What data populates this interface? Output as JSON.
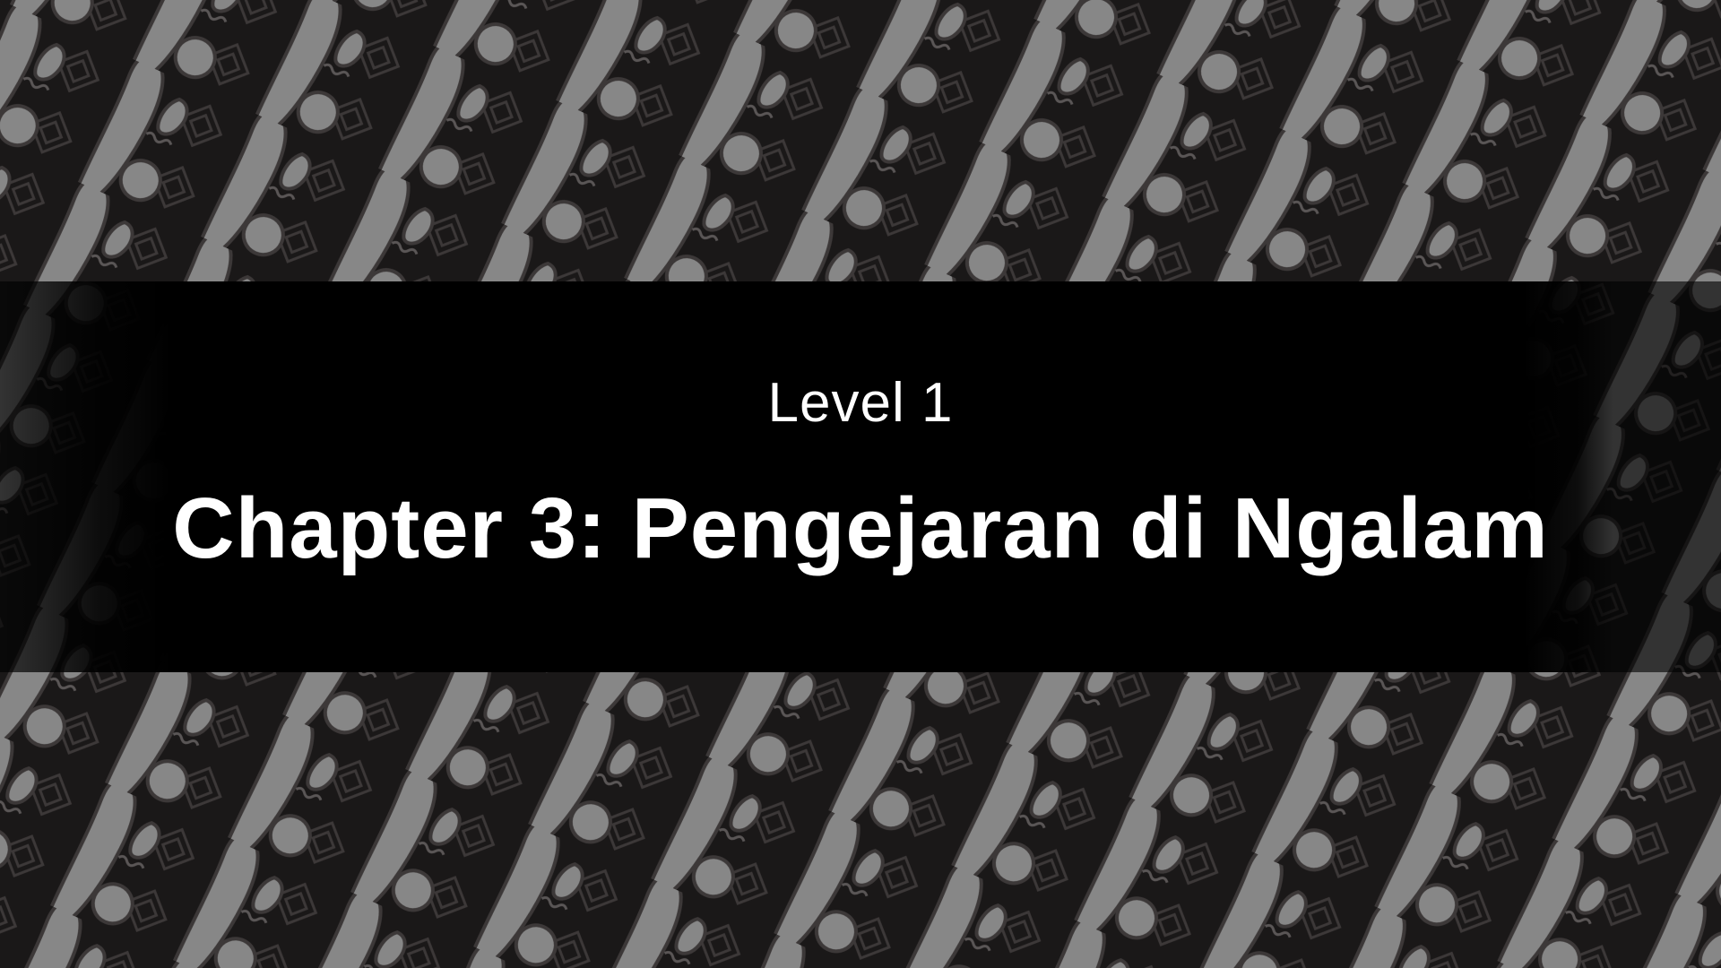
{
  "screen": {
    "level_label": "Level 1",
    "chapter_title": "Chapter 3: Pengejaran di Ngalam"
  },
  "background": {
    "pattern": "batik-parang-icon",
    "colors": {
      "base": "#1a1818",
      "motif": "#878787",
      "outline": "#3c3838",
      "banner": "#000000",
      "text": "#ffffff"
    }
  }
}
